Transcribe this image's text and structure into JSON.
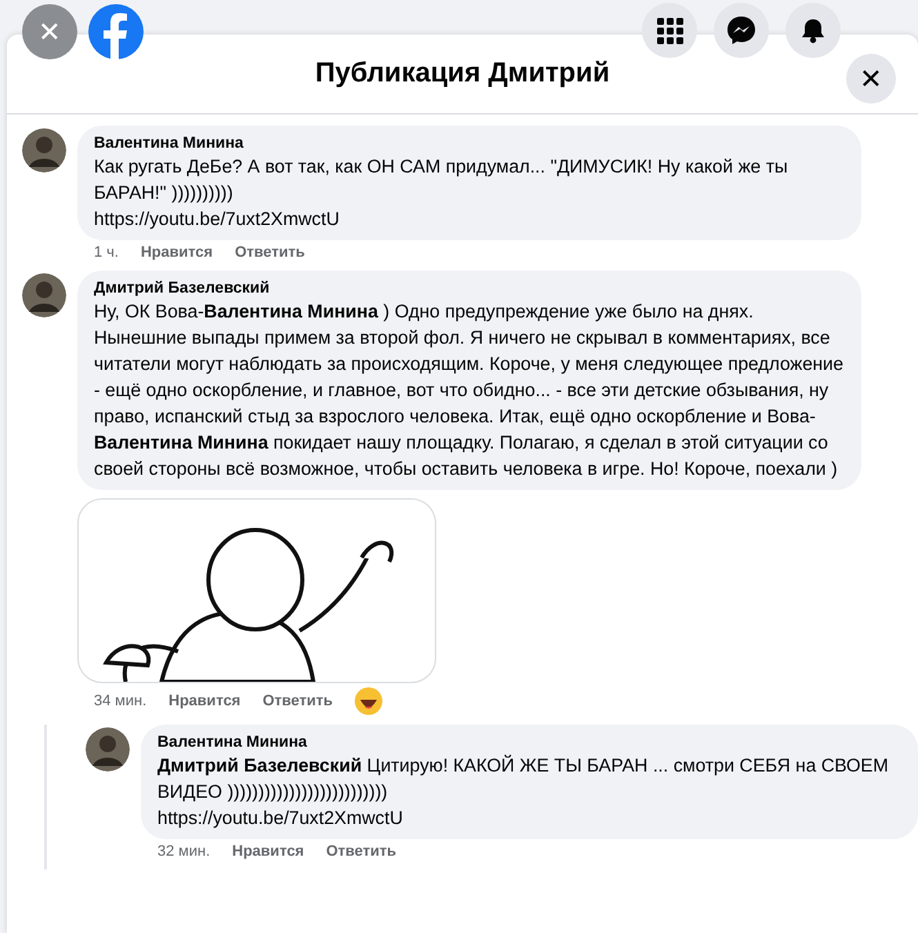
{
  "topbar": {
    "close_label": "✕"
  },
  "dialog": {
    "title": "Публикация Дмитрий",
    "close_label": "✕"
  },
  "comments": [
    {
      "kind": "text",
      "author": "Валентина Минина",
      "text": "Как ругать ДеБе? А вот так, как ОН САМ придумал... \"ДИМУСИК! Ну какой же ты БАРАН!\" ))))))))))",
      "link": "https://youtu.be/7uxt2XmwctU",
      "time": "1 ч.",
      "like": "Нравится",
      "reply": "Ответить"
    },
    {
      "kind": "text",
      "author": "Дмитрий Базелевский",
      "text": "Ну, ОК Вова-**Валентина Минина** ) Одно предупреждение уже было на днях. Нынешние выпады примем за второй фол. Я ничего не скрывал в комментариях, все читатели могут наблюдать за происходящим. Короче, у меня следующее предложение - ещё одно оскорбление, и главное, вот что обидно... - все эти детские обзывания, ну право, испанский стыд за взрослого человека. Итак, ещё одно оскорбление и Вова-**Валентина Минина** покидает нашу площадку. Полагаю, я сделал в этой ситуации со своей стороны всё возможное, чтобы оставить человека в игре. Но! Короче, поехали )",
      "sticker": true,
      "time": "34 мин.",
      "like": "Нравится",
      "reply": "Ответить",
      "reaction": true,
      "replies": [
        {
          "kind": "text",
          "author": "Валентина Минина",
          "text": "**Дмитрий Базелевский** Цитирую! КАКОЙ ЖЕ ТЫ БАРАН ... смотри СЕБЯ на СВОЕМ ВИДЕО ))))))))))))))))))))))))))",
          "link": "https://youtu.be/7uxt2XmwctU",
          "time": "32 мин.",
          "like": "Нравится",
          "reply": "Ответить"
        }
      ]
    }
  ]
}
